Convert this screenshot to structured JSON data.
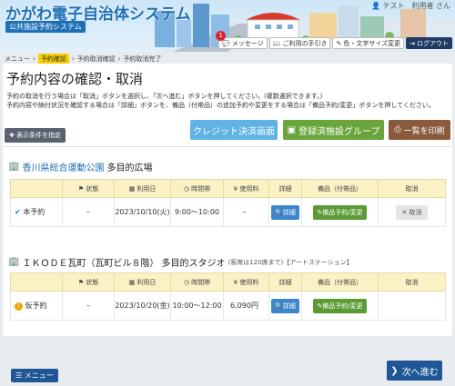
{
  "header": {
    "title": "かがわ電子自治体システム",
    "subtitle": "公共施設予約システム",
    "user": "テスト　利用者 さん",
    "notification_count": "1",
    "buttons": {
      "message": "メッセージ",
      "guide": "ご利用の手引き",
      "color_font": "色・文字サイズ変更",
      "logout": "ログアウト"
    }
  },
  "breadcrumb": [
    "メニュー",
    "予約確認",
    "予約取消確認",
    "予約取消完了"
  ],
  "page": {
    "title": "予約内容の確認・取消",
    "lead_1": "予約の取消を行う場合は「取消」ボタンを選択し、「次へ進む」ボタンを押してください。(複数選択できます。)",
    "lead_2": "予約内容や納付状況を確認する場合は「詳細」ボタンを、備品（付帯品）の追加予約や変更をする場合は「備品予約/変更」ボタンを押してください。"
  },
  "actions": {
    "filter": "表示条件を指定",
    "credit": "クレジット決済画面",
    "group": "登録済施設グループ",
    "print": "一覧を印刷"
  },
  "table_headers": [
    "状態",
    "利用日",
    "時間帯",
    "使用料",
    "詳細",
    "備品（付帯品）",
    "取消"
  ],
  "facilities": [
    {
      "name": "香川県総合運動公園",
      "room": "多目的広場",
      "note": "",
      "row": {
        "status": "本予約",
        "empty": "–",
        "date": "2023/10/10(火)",
        "time": "9:00～10:00",
        "fee": "–",
        "detail": "詳細",
        "equip": "備品予約/変更",
        "cancel": "取消"
      }
    },
    {
      "name": "ＩＫＯＤＥ瓦町（瓦町ビル８階）",
      "room": "多目的スタジオ",
      "note": "(客席は120席まで)【アートステーション】",
      "row": {
        "status": "仮予約",
        "empty": "–",
        "date": "2023/10/20(金)",
        "time": "10:00～12:00",
        "fee": "6,090円",
        "detail": "詳細",
        "equip": "備品予約/変更",
        "cancel": ""
      }
    }
  ],
  "footer": {
    "menu": "メニュー",
    "next": "次へ進む"
  }
}
